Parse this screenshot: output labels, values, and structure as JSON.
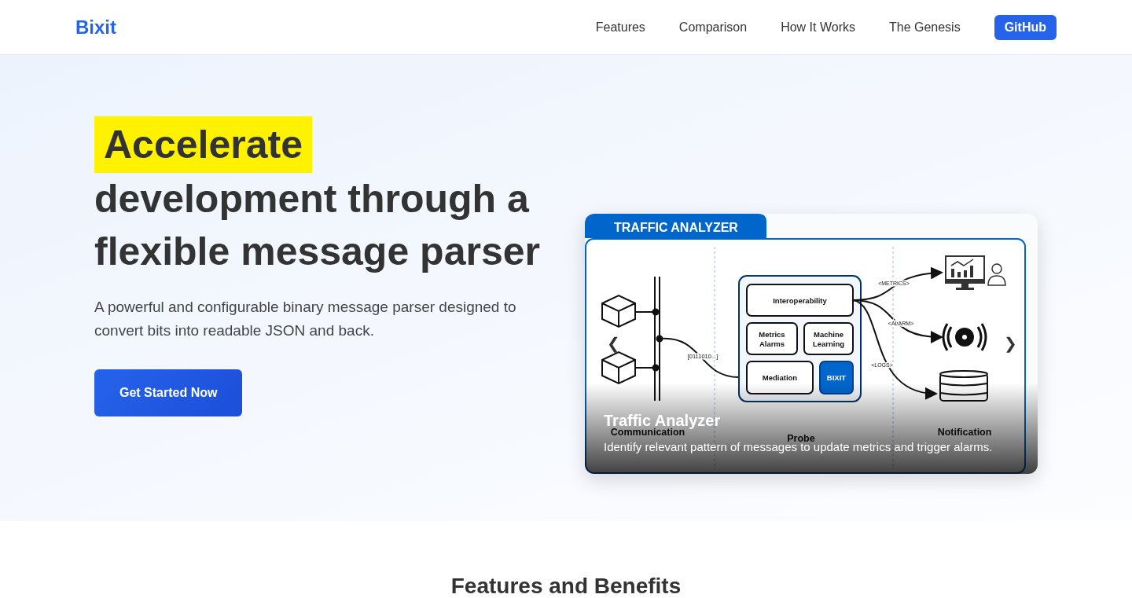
{
  "navbar": {
    "brand": "Bixit",
    "links": [
      {
        "label": "Features"
      },
      {
        "label": "Comparison"
      },
      {
        "label": "How It Works"
      },
      {
        "label": "The Genesis"
      }
    ],
    "github": "GitHub"
  },
  "hero": {
    "highlight": "Accelerate",
    "heading_rest": "development through a flexible message parser",
    "subtitle": "A powerful and configurable binary message parser designed to convert bits into readable JSON and back.",
    "cta": "Get Started Now"
  },
  "carousel": {
    "prev": "❮",
    "next": "❯",
    "slide": {
      "tab": "TRAFFIC ANALYZER",
      "diagram": {
        "bits": "[0111010...]",
        "interop": "Interoperability",
        "metrics": [
          "Metrics",
          "Alarms"
        ],
        "ml": [
          "Machine",
          "Learning"
        ],
        "mediation": "Mediation",
        "bixit": "BIXIT",
        "flows": [
          "<METRICS>",
          "<ALARM>",
          "<LOGS>"
        ],
        "columns": [
          "Communication",
          "Probe",
          "Notification"
        ]
      },
      "caption_title": "Traffic Analyzer",
      "caption_text": "Identify relevant pattern of messages to update metrics and trigger alarms."
    }
  },
  "features": {
    "heading": "Features and Benefits"
  }
}
